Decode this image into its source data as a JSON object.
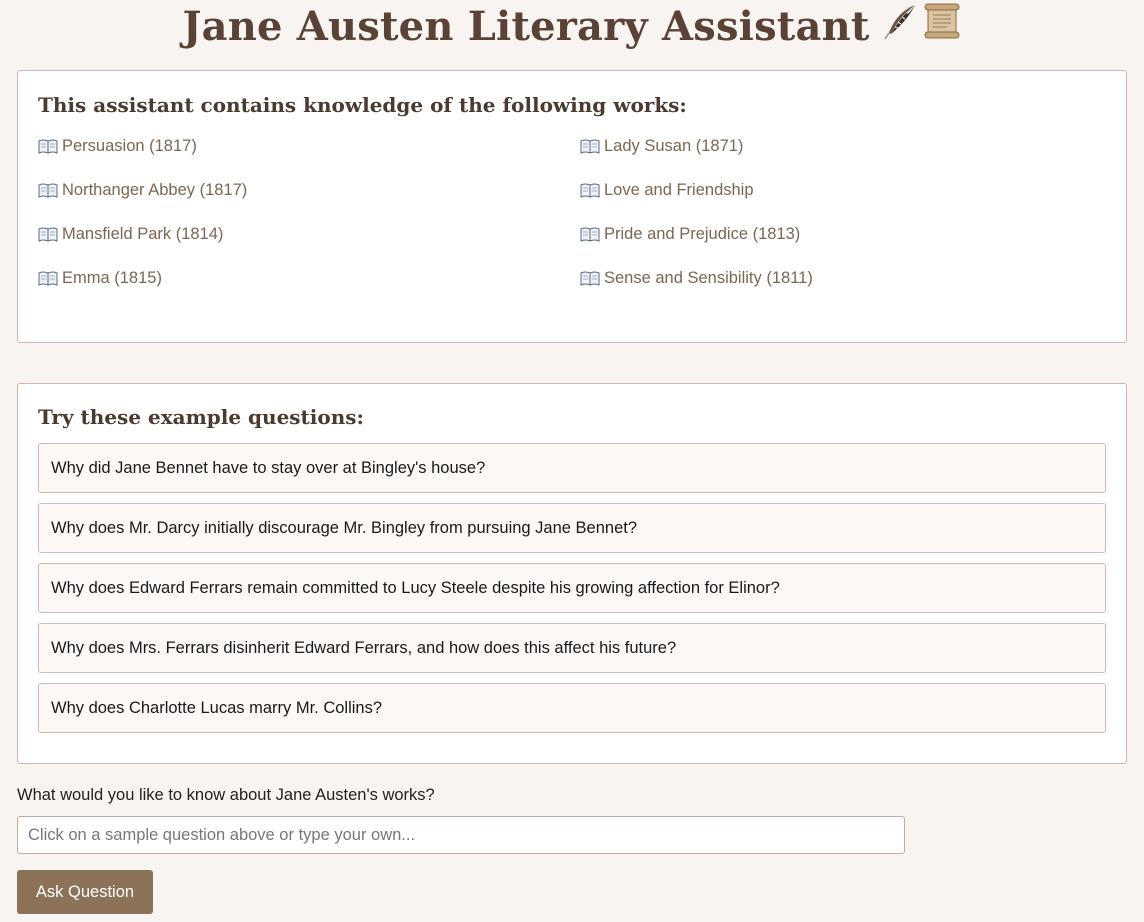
{
  "header": {
    "title": "Jane Austen Literary Assistant",
    "icons": [
      "feather-icon",
      "scroll-icon"
    ]
  },
  "works_panel": {
    "heading": "This assistant contains knowledge of the following works:",
    "icon": "open-book-icon",
    "works": [
      "Persuasion (1817)",
      "Northanger Abbey (1817)",
      "Mansfield Park (1814)",
      "Emma (1815)",
      "Lady Susan (1871)",
      "Love and Friendship",
      "Pride and Prejudice (1813)",
      "Sense and Sensibility (1811)"
    ]
  },
  "questions_panel": {
    "heading": "Try these example questions:",
    "questions": [
      "Why did Jane Bennet have to stay over at Bingley's house?",
      "Why does Mr. Darcy initially discourage Mr. Bingley from pursuing Jane Bennet?",
      "Why does Edward Ferrars remain committed to Lucy Steele despite his growing affection for Elinor?",
      "Why does Mrs. Ferrars disinherit Edward Ferrars, and how does this affect his future?",
      "Why does Charlotte Lucas marry Mr. Collins?"
    ]
  },
  "ask": {
    "label": "What would you like to know about Jane Austen's works?",
    "placeholder": "Click on a sample question above or type your own...",
    "value": "",
    "button_label": "Ask Question"
  },
  "colors": {
    "background": "#f8f4f1",
    "title": "#5a4336",
    "work_link": "#7b6652",
    "panel_border": "#d4b6b6",
    "button": "#8c7357"
  }
}
